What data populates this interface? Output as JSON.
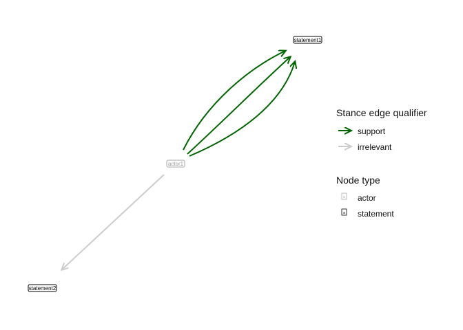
{
  "nodes": [
    {
      "id": "statement1",
      "label": "statement1",
      "type": "statement"
    },
    {
      "id": "actor1",
      "label": "actor1",
      "type": "actor"
    },
    {
      "id": "statement2",
      "label": "statement2",
      "type": "statement"
    }
  ],
  "edges": [
    {
      "from": "actor1",
      "to": "statement1",
      "qualifier": "support"
    },
    {
      "from": "actor1",
      "to": "statement1",
      "qualifier": "support"
    },
    {
      "from": "actor1",
      "to": "statement1",
      "qualifier": "support"
    },
    {
      "from": "actor1",
      "to": "statement2",
      "qualifier": "irrelevant"
    }
  ],
  "colors": {
    "support": "#006400",
    "irrelevant": "#cccccc",
    "actor": "#aaaaaa",
    "statement": "#000000"
  },
  "legend": {
    "edge_title": "Stance edge qualifier",
    "edge_items": [
      {
        "label": "support",
        "qualifier": "support"
      },
      {
        "label": "irrelevant",
        "qualifier": "irrelevant"
      }
    ],
    "node_title": "Node type",
    "node_items": [
      {
        "label": "actor",
        "type": "actor"
      },
      {
        "label": "statement",
        "type": "statement"
      }
    ]
  }
}
